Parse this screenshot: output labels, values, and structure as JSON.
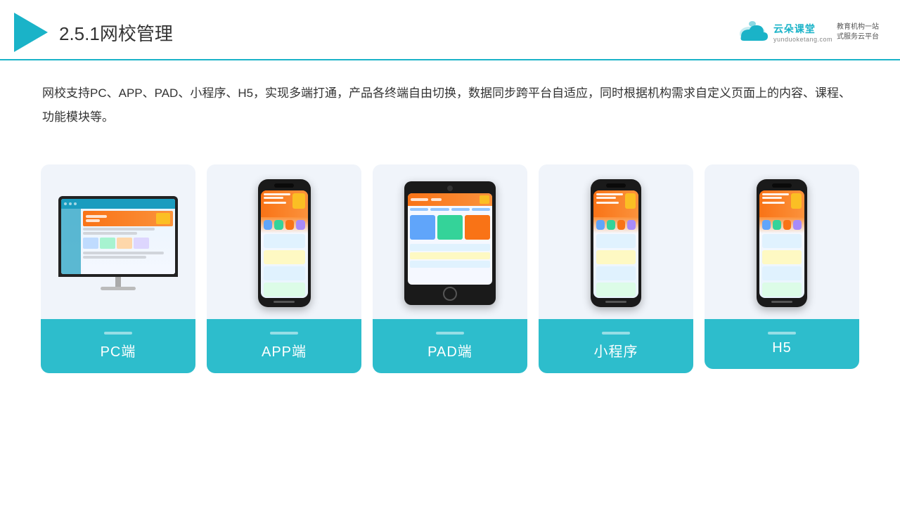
{
  "header": {
    "title_prefix": "2.5.1",
    "title_main": "网校管理",
    "logo_cloud_text": "云朵课堂",
    "logo_domain": "yunduoketang.com",
    "logo_tagline_line1": "教育机构一站",
    "logo_tagline_line2": "式服务云平台"
  },
  "description": {
    "text": "网校支持PC、APP、PAD、小程序、H5，实现多端打通，产品各终端自由切换，数据同步跨平台自适应，同时根据机构需求自定义页面上的内容、课程、功能模块等。"
  },
  "cards": [
    {
      "id": "pc",
      "label": "PC端"
    },
    {
      "id": "app",
      "label": "APP端"
    },
    {
      "id": "pad",
      "label": "PAD端"
    },
    {
      "id": "miniprogram",
      "label": "小程序"
    },
    {
      "id": "h5",
      "label": "H5"
    }
  ],
  "brand": {
    "accent_color": "#1ab3c8",
    "label_bg": "#2dbdcc"
  }
}
